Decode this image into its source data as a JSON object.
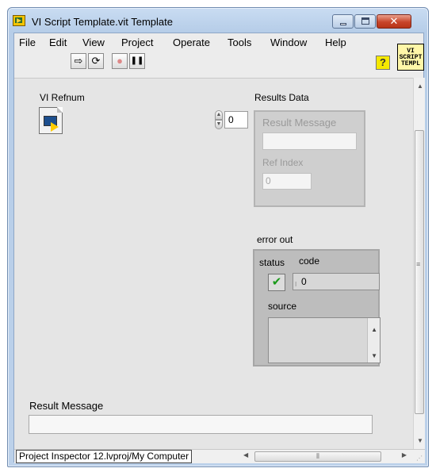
{
  "window": {
    "title": "VI Script Template.vit Template",
    "close_glyph": "✕"
  },
  "menu": [
    "File",
    "Edit",
    "View",
    "Project",
    "Operate",
    "Tools",
    "Window",
    "Help"
  ],
  "toolbar": {
    "run_glyph": "⇨",
    "run_continuous_glyph": "⟳",
    "abort_glyph": "●",
    "pause_glyph": "❚❚",
    "help_glyph": "?"
  },
  "vi_icon": {
    "lines": [
      "VI",
      "SCRIPT",
      "TEMPL"
    ]
  },
  "front_panel": {
    "vi_refnum_label": "VI Refnum",
    "results_data": {
      "label": "Results Data",
      "array_index": "0",
      "result_message_label": "Result Message",
      "result_message_value": "",
      "ref_index_label": "Ref Index",
      "ref_index_value": "0"
    },
    "error_out": {
      "label": "error out",
      "status_label": "status",
      "status_glyph": "✔",
      "code_label": "code",
      "code_value": "0",
      "source_label": "source",
      "source_value": ""
    },
    "result_message": {
      "label": "Result Message",
      "value": ""
    }
  },
  "statusbar": {
    "path": "Project Inspector 12.lvproj/My Computer"
  },
  "colors": {
    "window_frame": "#b6cde8",
    "panel_bg": "#e5e5e5",
    "status_ok": "#1a9a1a",
    "close_button": "#c8452a"
  }
}
